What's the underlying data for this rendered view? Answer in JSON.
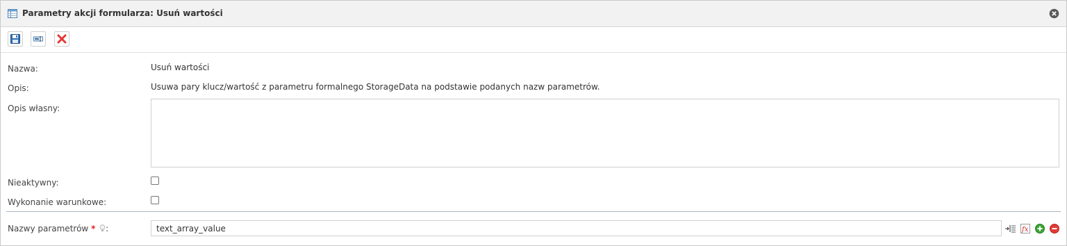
{
  "dialog": {
    "title": "Parametry akcji formularza: Usuń wartości"
  },
  "toolbar": {
    "buttons": [
      {
        "icon": "save-icon"
      },
      {
        "icon": "rename-icon"
      },
      {
        "icon": "delete-icon"
      }
    ]
  },
  "form": {
    "name_label": "Nazwa:",
    "name_value": "Usuń wartości",
    "description_label": "Opis:",
    "description_value": "Usuwa pary klucz/wartość z parametru formalnego StorageData na podstawie podanych nazw parametrów.",
    "custom_description_label": "Opis własny:",
    "custom_description_value": "",
    "inactive_label": "Nieaktywny:",
    "inactive_checked": false,
    "conditional_label": "Wykonanie warunkowe:",
    "conditional_checked": false,
    "param_names_label": "Nazwy parametrów",
    "param_names_required": "*",
    "param_names_colon": ":",
    "param_names_value": "text_array_value"
  },
  "colors": {
    "required": "#e02020",
    "add": "#3aa635",
    "remove": "#e53935",
    "delete": "#e53935",
    "save": "#2f6fb3"
  }
}
